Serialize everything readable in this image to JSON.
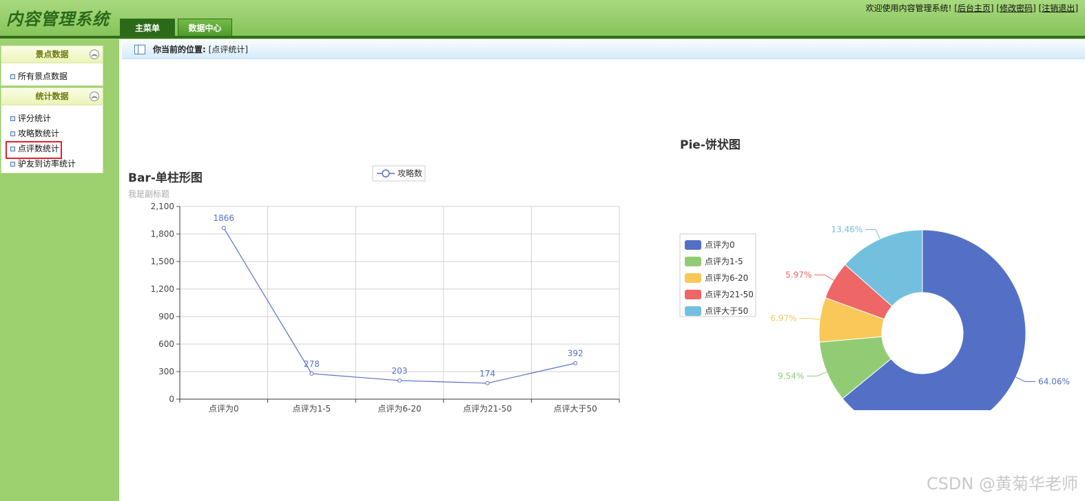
{
  "header": {
    "logo": "内容管理系统",
    "tabs": [
      "主菜单",
      "数据中心"
    ],
    "welcome": "欢迎使用内容管理系统!",
    "links": [
      "后台主页",
      "修改密码",
      "注销退出"
    ]
  },
  "sidebar": {
    "panels": [
      {
        "title": "景点数据",
        "items": [
          "所有景点数据"
        ]
      },
      {
        "title": "统计数据",
        "items": [
          "评分统计",
          "攻略数统计",
          "点评数统计",
          "驴友到访率统计"
        ]
      }
    ]
  },
  "breadcrumb": {
    "label": "你当前的位置:",
    "value": "[点评统计]"
  },
  "chart_data": [
    {
      "type": "line",
      "title": "Bar-单柱形图",
      "subtitle": "我是副标题",
      "categories": [
        "点评为0",
        "点评为1-5",
        "点评为6-20",
        "点评为21-50",
        "点评大于50"
      ],
      "series": [
        {
          "name": "攻略数",
          "values": [
            1866,
            278,
            203,
            174,
            392
          ]
        }
      ],
      "ylim": [
        0,
        2100
      ],
      "yticks": [
        0,
        300,
        600,
        900,
        1200,
        1500,
        1800,
        2100
      ],
      "ytick_labels": [
        "0",
        "300",
        "600",
        "900",
        "1,200",
        "1,500",
        "1,800",
        "2,100"
      ],
      "legend": "top-center",
      "grid": true,
      "color": "#5470c6"
    },
    {
      "type": "pie",
      "title": "Pie-饼状图",
      "legend": "top-left",
      "donut": true,
      "slices": [
        {
          "label": "点评为0",
          "percent": 64.06,
          "percent_label": "64.06%",
          "color": "#5470c6"
        },
        {
          "label": "点评为1-5",
          "percent": 9.54,
          "percent_label": "9.54%",
          "color": "#91cc75"
        },
        {
          "label": "点评为6-20",
          "percent": 6.97,
          "percent_label": "6.97%",
          "color": "#fac858"
        },
        {
          "label": "点评为21-50",
          "percent": 5.97,
          "percent_label": "5.97%",
          "color": "#ee6666"
        },
        {
          "label": "点评大于50",
          "percent": 13.46,
          "percent_label": "13.46%",
          "color": "#73c0de"
        }
      ]
    }
  ],
  "watermark": "CSDN @黄菊华老师"
}
